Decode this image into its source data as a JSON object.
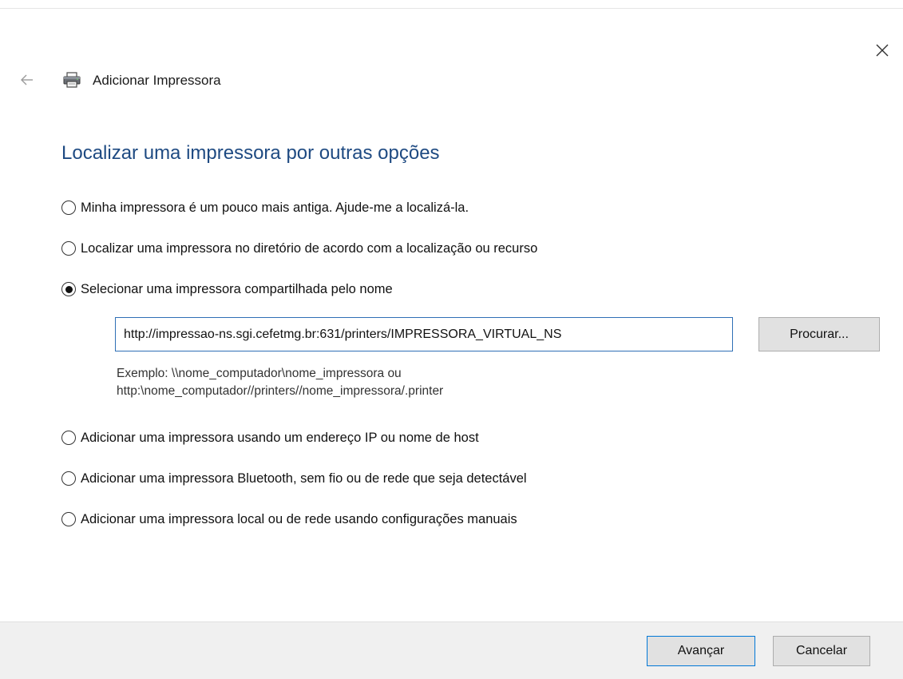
{
  "window": {
    "title": "Adicionar Impressora"
  },
  "main": {
    "heading": "Localizar uma impressora por outras opções",
    "options": [
      {
        "label": "Minha impressora é um pouco mais antiga. Ajude-me a localizá-la.",
        "selected": false
      },
      {
        "label": "Localizar uma impressora no diretório de acordo com a localização ou recurso",
        "selected": false
      },
      {
        "label": "Selecionar uma impressora compartilhada pelo nome",
        "selected": true
      },
      {
        "label": "Adicionar uma impressora usando um endereço IP ou nome de host",
        "selected": false
      },
      {
        "label": "Adicionar uma impressora Bluetooth, sem fio ou de rede que seja detectável",
        "selected": false
      },
      {
        "label": "Adicionar uma impressora local ou de rede usando configurações manuais",
        "selected": false
      }
    ],
    "shared_name": {
      "value": "http://impressao-ns.sgi.cefetmg.br:631/printers/IMPRESSORA_VIRTUAL_NS",
      "browse_label": "Procurar...",
      "example_line1": "Exemplo: \\\\nome_computador\\nome_impressora ou",
      "example_line2": "http:\\nome_computador//printers//nome_impressora/.printer"
    }
  },
  "footer": {
    "next_label": "Avançar",
    "cancel_label": "Cancelar"
  },
  "colors": {
    "heading": "#1e4a82",
    "input_border": "#2f6fb5",
    "default_button_border": "#0078d7",
    "footer_bg": "#f0f0f0"
  },
  "icons": {
    "close": "close-icon",
    "back": "back-arrow-icon",
    "printer": "printer-icon"
  }
}
